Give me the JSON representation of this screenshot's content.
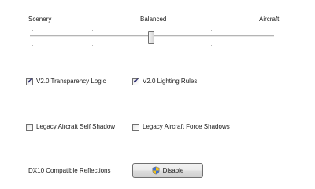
{
  "slider": {
    "left_label": "Scenery",
    "center_label": "Balanced",
    "right_label": "Aircraft",
    "tick_count": 7,
    "value": 0.5
  },
  "options": {
    "v2_transparency": {
      "label": "V2.0 Transparency Logic",
      "checked": true
    },
    "v2_lighting": {
      "label": "V2.0 Lighting Rules",
      "checked": true
    },
    "legacy_self_shadow": {
      "label": "Legacy Aircraft Self Shadow",
      "checked": false
    },
    "legacy_force_shadows": {
      "label": "Legacy Aircraft Force Shadows",
      "checked": false
    }
  },
  "dx10": {
    "label": "DX10 Compatible Reflections",
    "button_label": "Disable",
    "button_icon": "uac-shield-icon"
  },
  "colors": {
    "check_mark": "#2b2b6e",
    "shield_blue": "#3a6fd8",
    "shield_yellow": "#f2c21b"
  }
}
